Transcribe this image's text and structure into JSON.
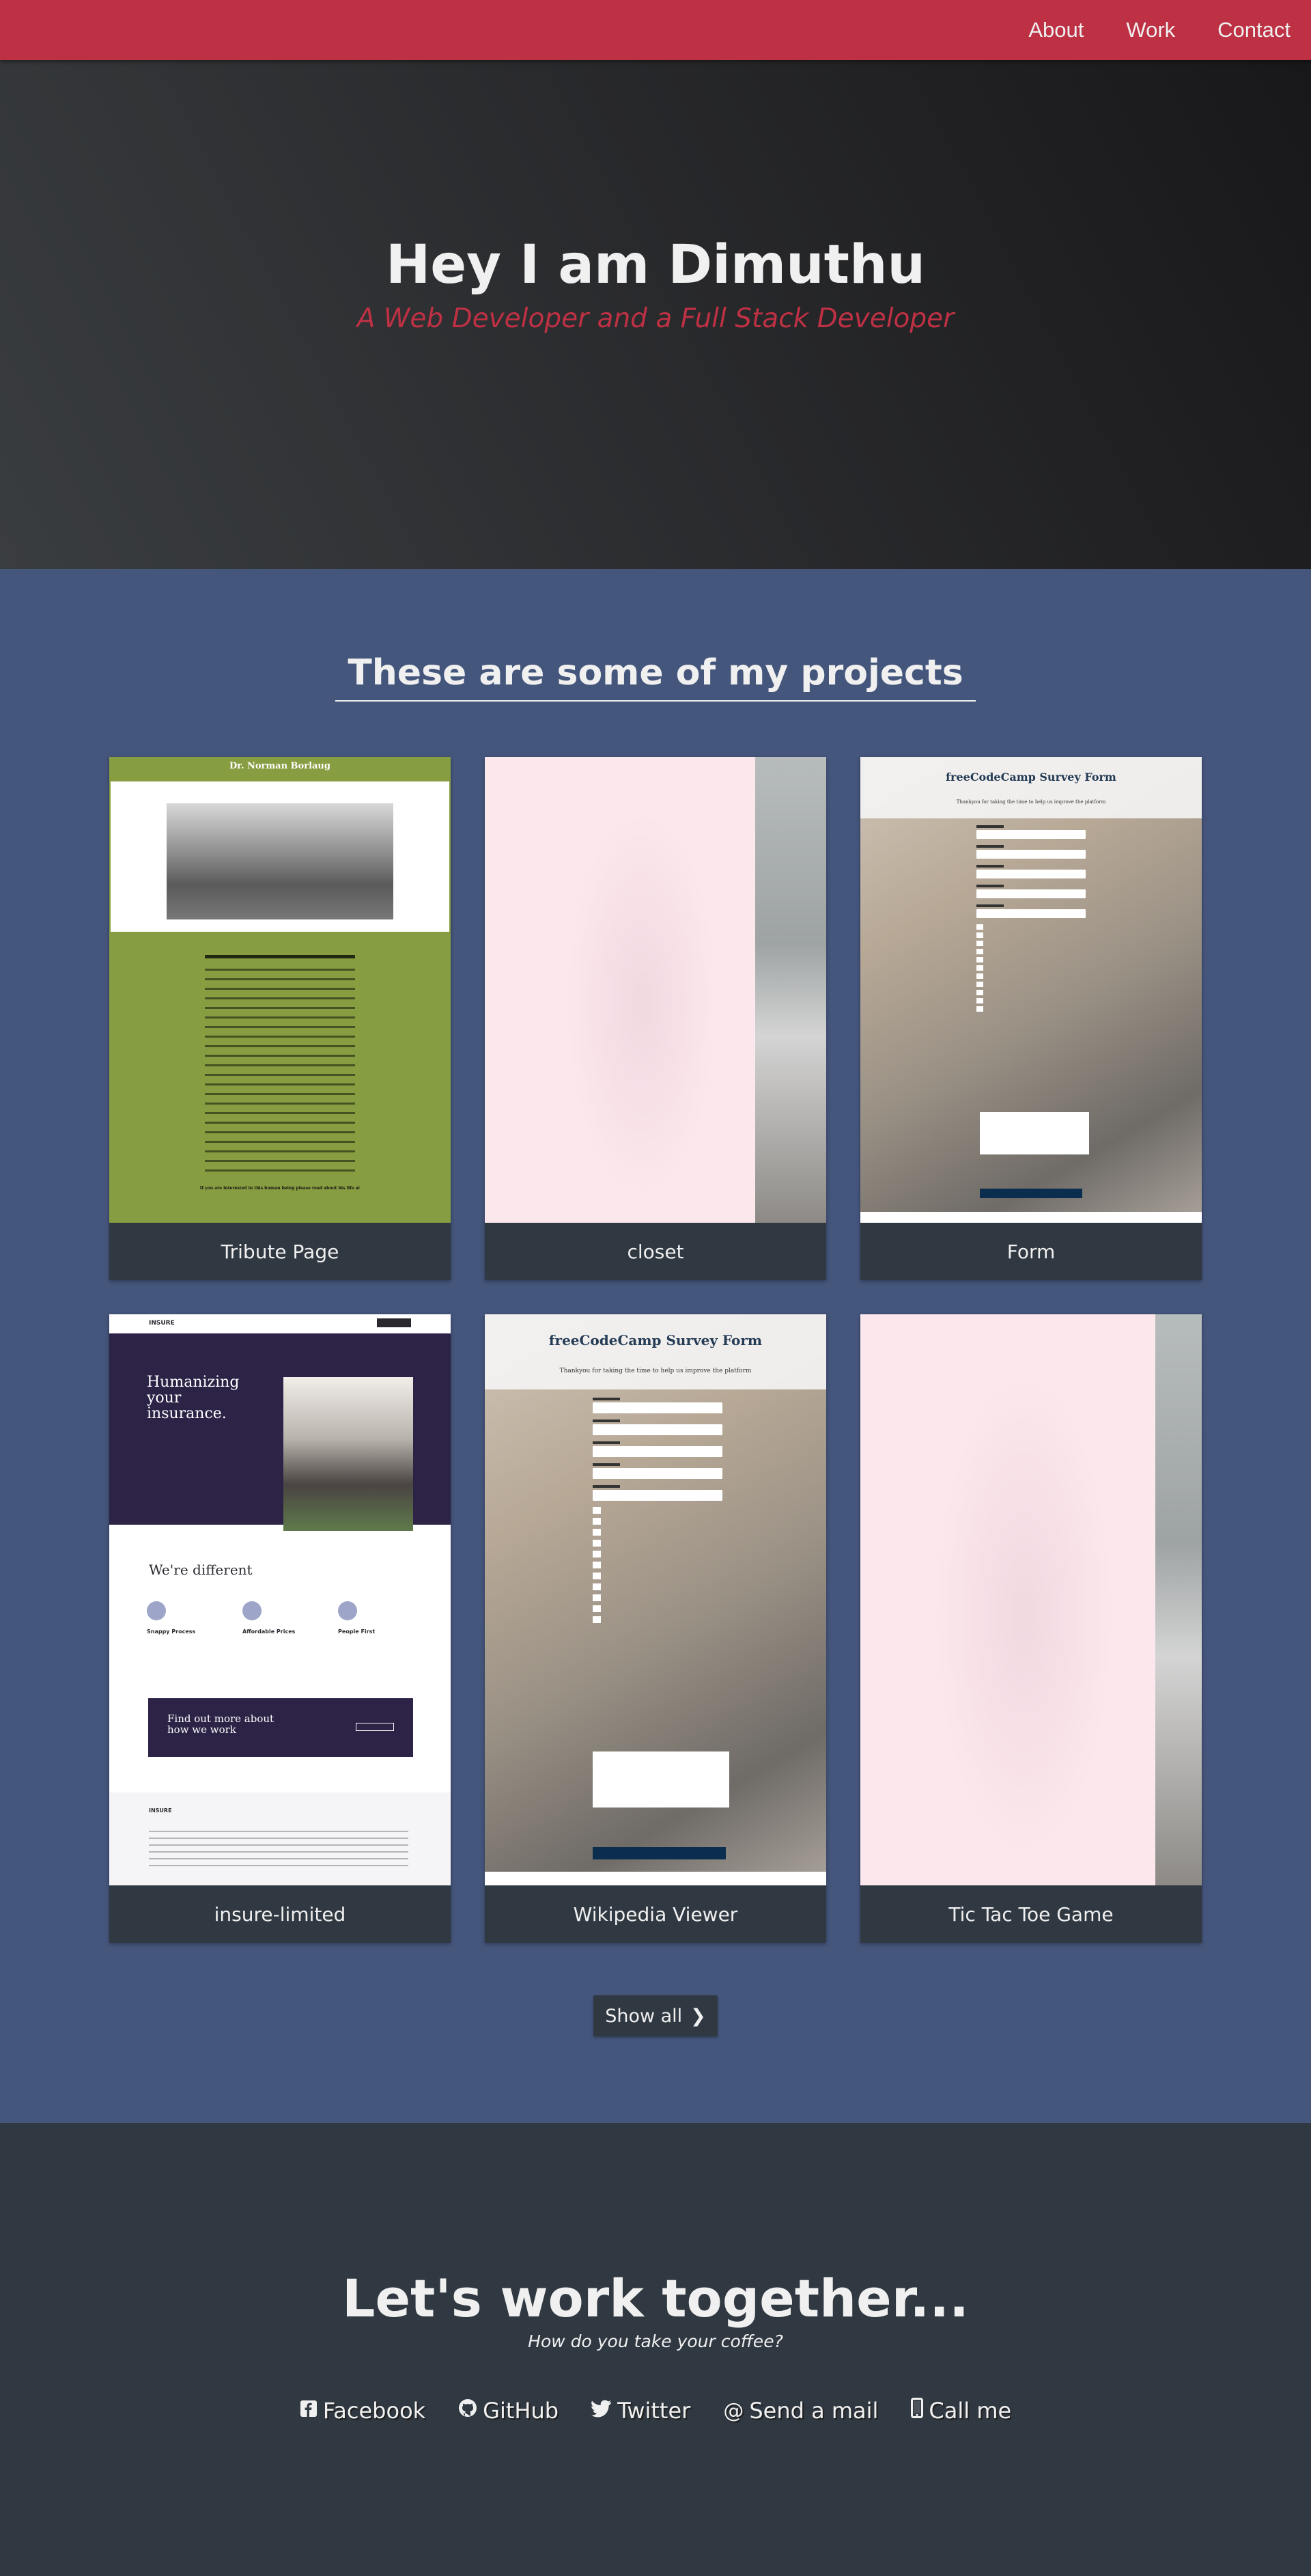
{
  "nav": {
    "items": [
      {
        "label": "About"
      },
      {
        "label": "Work"
      },
      {
        "label": "Contact"
      }
    ]
  },
  "hero": {
    "title": "Hey I am Dimuthu",
    "subtitle": "A Web Developer and a Full Stack Developer"
  },
  "projects": {
    "heading": "These are some of my projects",
    "cards": [
      {
        "label": "Tribute Page",
        "thumb_title": "Dr. Norman Borlaug",
        "thumb_footer": "If you are interested in this human being please read about his life at"
      },
      {
        "label": "closet"
      },
      {
        "label": "Form",
        "thumb_title": "freeCodeCamp Survey Form",
        "thumb_sub": "Thankyou for taking the time to help us improve the platform"
      },
      {
        "label": "insure-limited",
        "thumb_brand": "INSURE",
        "thumb_headline": "Humanizing your insurance.",
        "thumb_diff": "We're different",
        "thumb_cta": "Find out more about how we work",
        "thumb_features": [
          "Snappy Process",
          "Affordable Prices",
          "People First"
        ]
      },
      {
        "label": "Wikipedia Viewer",
        "thumb_title": "freeCodeCamp Survey Form",
        "thumb_sub": "Thankyou for taking the time to help us improve the platform"
      },
      {
        "label": "Tic Tac Toe Game"
      }
    ],
    "show_all": "Show all"
  },
  "contact": {
    "heading": "Let's work together...",
    "tagline": "How do you take your coffee?",
    "links": [
      {
        "label": "Facebook",
        "icon": "facebook-icon"
      },
      {
        "label": "GitHub",
        "icon": "github-icon"
      },
      {
        "label": "Twitter",
        "icon": "twitter-icon"
      },
      {
        "label": "Send a mail",
        "icon": "at-icon"
      },
      {
        "label": "Call me",
        "icon": "mobile-icon"
      }
    ]
  },
  "colors": {
    "nav": "#be3144",
    "projects_bg": "#45567d",
    "dark": "#303841",
    "tribute_green": "#879d41"
  }
}
